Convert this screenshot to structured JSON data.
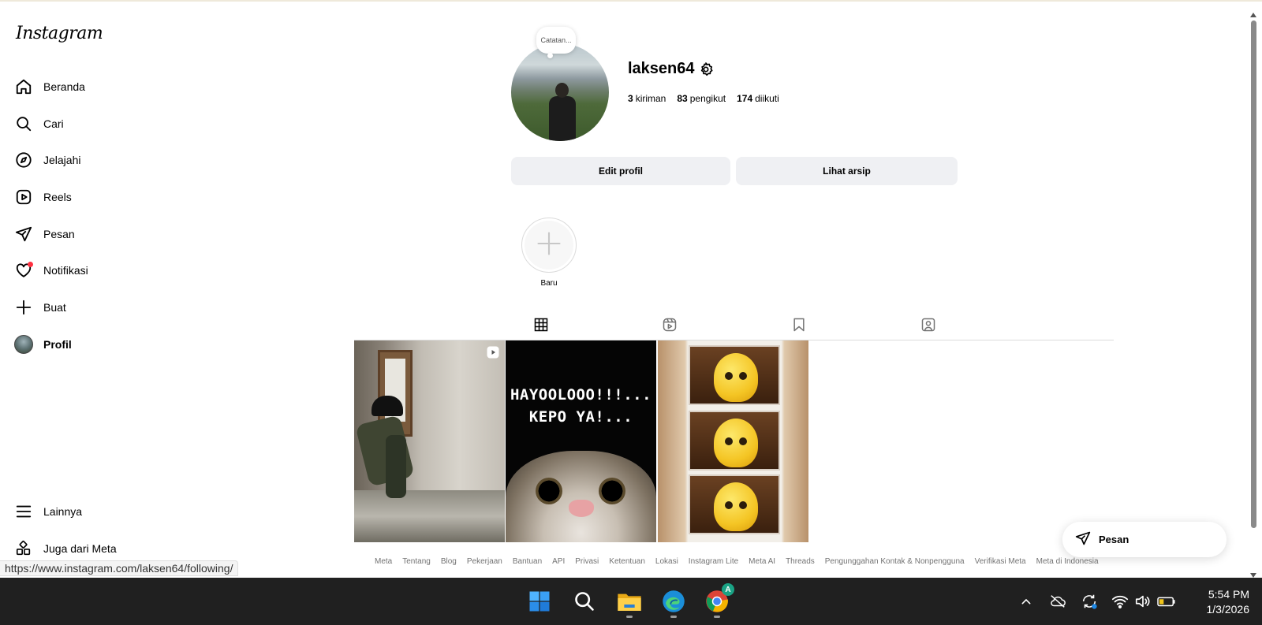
{
  "brand": "Instagram",
  "sidebar": {
    "items": [
      {
        "label": "Beranda",
        "icon": "home-icon"
      },
      {
        "label": "Cari",
        "icon": "search-icon"
      },
      {
        "label": "Jelajahi",
        "icon": "compass-icon"
      },
      {
        "label": "Reels",
        "icon": "reels-icon"
      },
      {
        "label": "Pesan",
        "icon": "send-icon"
      },
      {
        "label": "Notifikasi",
        "icon": "heart-icon"
      },
      {
        "label": "Buat",
        "icon": "plus-icon"
      },
      {
        "label": "Profil",
        "icon": "avatar"
      }
    ],
    "more_label": "Lainnya",
    "meta_label": "Juga dari Meta"
  },
  "profile": {
    "note": "Catatan...",
    "username": "laksen64",
    "stats": [
      {
        "value": "3",
        "label": "kiriman"
      },
      {
        "value": "83",
        "label": "pengikut"
      },
      {
        "value": "174",
        "label": "diikuti"
      }
    ],
    "edit_button": "Edit profil",
    "archive_button": "Lihat arsip",
    "highlight_new": "Baru"
  },
  "tabs": [
    "posts-grid-icon",
    "reels-tab-icon",
    "saved-bookmark-icon",
    "tagged-icon"
  ],
  "posts": [
    {
      "type": "reel"
    },
    {
      "type": "image",
      "text_line1": "HAYOOLOOO!!!...",
      "text_line2": "KEPO YA!..."
    },
    {
      "type": "image"
    }
  ],
  "footer": [
    "Meta",
    "Tentang",
    "Blog",
    "Pekerjaan",
    "Bantuan",
    "API",
    "Privasi",
    "Ketentuan",
    "Lokasi",
    "Instagram Lite",
    "Meta AI",
    "Threads",
    "Pengunggahan Kontak & Nonpengguna",
    "Verifikasi Meta",
    "Meta di Indonesia"
  ],
  "status_url": "https://www.instagram.com/laksen64/following/",
  "message_pill": "Pesan",
  "taskbar": {
    "apps": [
      "windows-start-icon",
      "search-icon",
      "file-explorer-icon",
      "edge-icon",
      "chrome-icon"
    ],
    "chrome_badge": "A",
    "time": "5:54 PM",
    "date": "1/3/2026"
  },
  "colors": {
    "notification_dot": "#ff3040",
    "button_bg": "#eff0f3",
    "taskbar_bg": "#202020"
  }
}
